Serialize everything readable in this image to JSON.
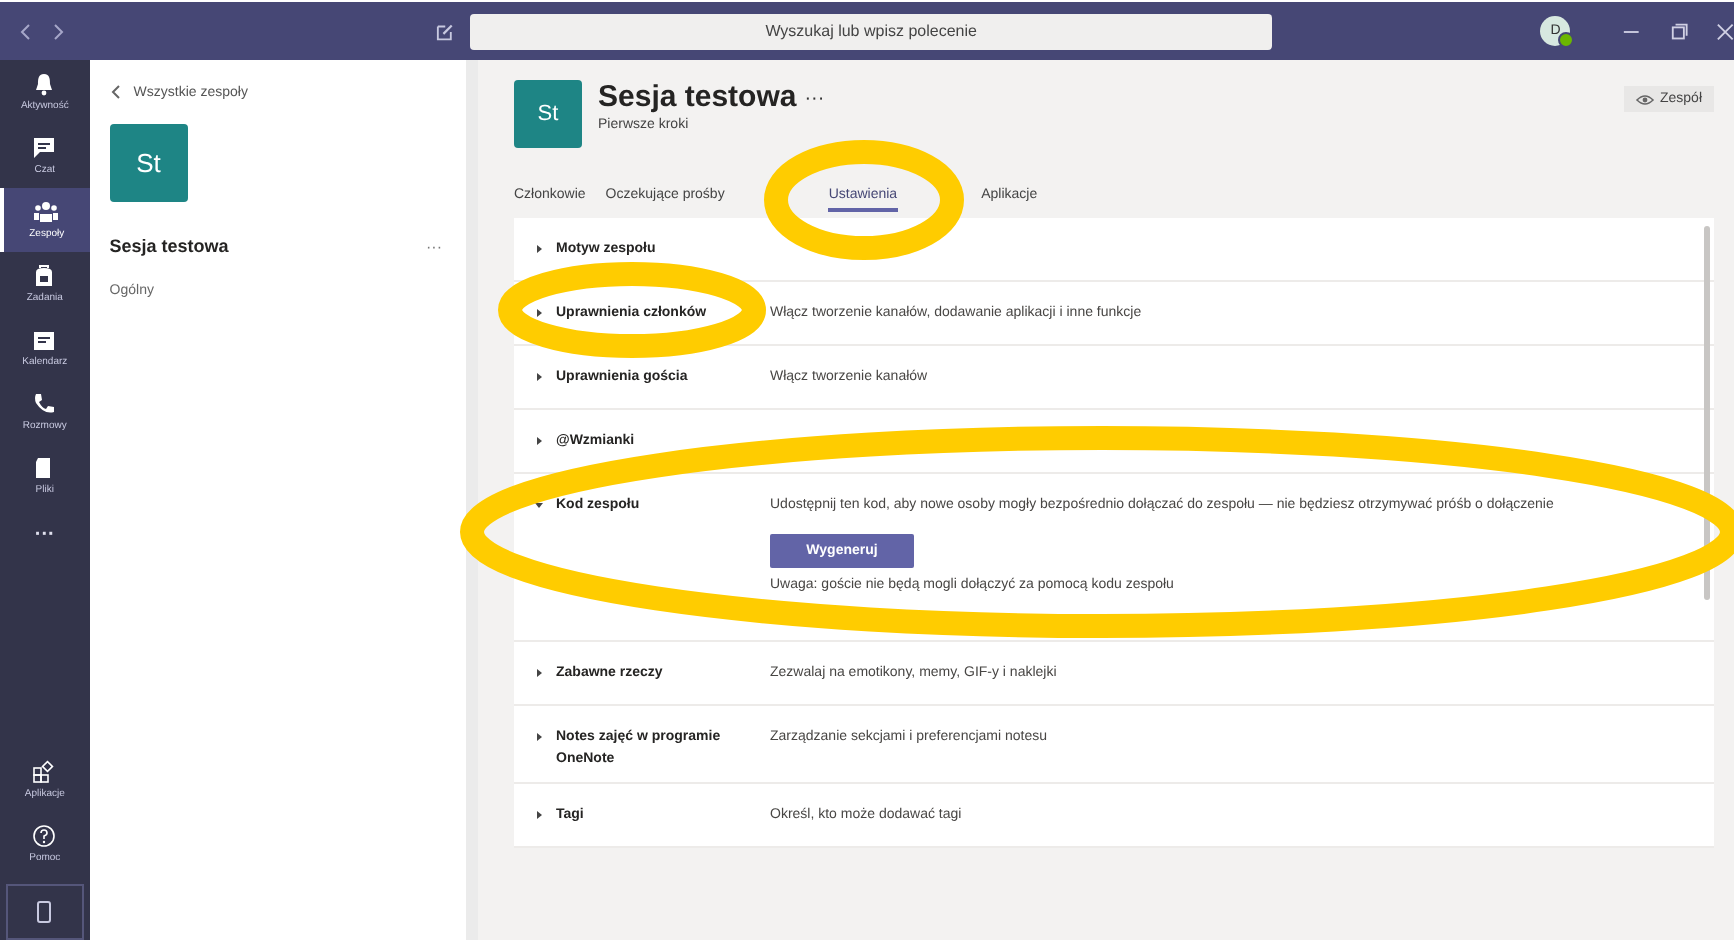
{
  "title_bar": {
    "search": {
      "placeholder": "Wyszukaj lub wpisz polecenie"
    },
    "avatar": "D"
  },
  "rail": {
    "items": [
      {
        "kind": "activity",
        "label": "Aktywność",
        "selected": false
      },
      {
        "kind": "chat",
        "label": "Czat",
        "selected": false
      },
      {
        "kind": "teams",
        "label": "Zespoły",
        "selected": true
      },
      {
        "kind": "assignments",
        "label": "Zadania",
        "selected": false
      },
      {
        "kind": "calendar",
        "label": "Kalendarz",
        "selected": false
      },
      {
        "kind": "calls",
        "label": "Rozmowy",
        "selected": false
      },
      {
        "kind": "files",
        "label": "Pliki",
        "selected": false
      },
      {
        "kind": "more",
        "label": "···",
        "selected": false
      }
    ],
    "bottom": [
      {
        "kind": "apps",
        "label": "Aplikacje"
      },
      {
        "kind": "help",
        "label": "Pomoc"
      }
    ]
  },
  "team_panel": {
    "back": "Wszystkie zespoły",
    "avatar": "St",
    "name": "Sesja testowa",
    "more": "···",
    "channels": [
      "Ogólny"
    ]
  },
  "header": {
    "avatar": "St",
    "title": "Sesja testowa",
    "more": "···",
    "subtitle": "Pierwsze kroki",
    "team_button": "Zespół"
  },
  "tabs": [
    {
      "label": "Członkowie",
      "selected": false
    },
    {
      "label": "Oczekujące prośby",
      "selected": false
    },
    {
      "label": "Ustawienia",
      "selected": true
    },
    {
      "label": "Aplikacje",
      "selected": false
    }
  ],
  "settings": [
    {
      "title": "Motyw zespołu",
      "expanded": false
    },
    {
      "title": "Uprawnienia członków",
      "description": "Włącz tworzenie kanałów, dodawanie aplikacji i inne funkcje",
      "expanded": false
    },
    {
      "title": "Uprawnienia gościa",
      "description": "Włącz tworzenie kanałów",
      "expanded": false
    },
    {
      "title": "@Wzmianki",
      "expanded": false
    },
    {
      "title": "Kod zespołu",
      "description": "Udostępnij ten kod, aby nowe osoby mogły bezpośrednio dołączać do zespołu — nie będziesz otrzymywać próśb o dołączenie",
      "expanded": true,
      "button": "Wygeneruj",
      "note": "Uwaga: goście nie będą mogli dołączyć za pomocą kodu zespołu"
    },
    {
      "title": "Zabawne rzeczy",
      "description": "Zezwalaj na emotikony, memy, GIF-y i naklejki",
      "expanded": false
    },
    {
      "title": "Notes zajęć w programie OneNote",
      "description": "Zarządzanie sekcjami i preferencjami notesu",
      "expanded": false
    },
    {
      "title": "Tagi",
      "description": "Określ, kto może dodawać tagi",
      "expanded": false
    }
  ]
}
